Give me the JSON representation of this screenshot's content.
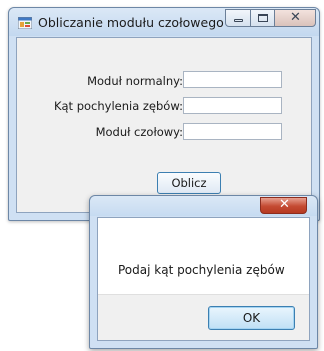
{
  "main_window": {
    "title": "Obliczanie modułu czołowego",
    "icon": "application-icon",
    "caption_buttons": {
      "minimize_icon": "minimize-icon",
      "maximize_icon": "maximize-icon",
      "close_icon": "close-icon",
      "close_glyph": "✕"
    },
    "fields": [
      {
        "label": "Moduł normalny:",
        "value": ""
      },
      {
        "label": "Kąt pochylenia zębów:",
        "value": ""
      },
      {
        "label": "Moduł czołowy:",
        "value": ""
      }
    ],
    "calc_button_label": "Oblicz"
  },
  "message_box": {
    "close_glyph": "✕",
    "message": "Podaj kąt pochylenia zębów",
    "ok_label": "OK"
  },
  "colors": {
    "window_frame": "#cfe0f3",
    "message_close_red": "#c44a32",
    "button_border": "#3c7fb1"
  }
}
